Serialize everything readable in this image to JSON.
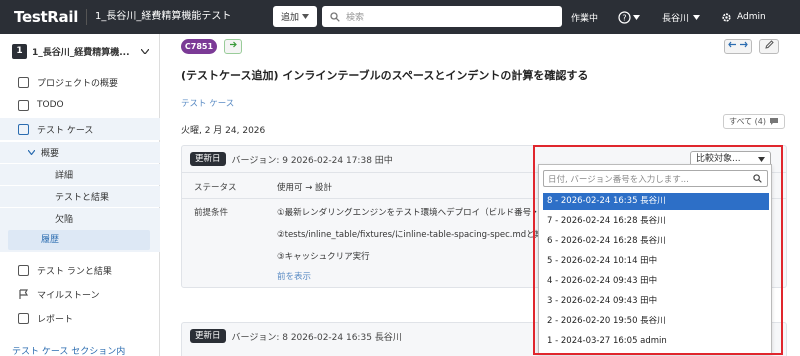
{
  "topbar": {
    "logo": "TestRail",
    "project_title": "1_長谷川_経費精算機能テスト",
    "add_label": "追加",
    "search_placeholder": "検索",
    "status": "作業中",
    "user": "長谷川",
    "admin": "Admin"
  },
  "sidebar": {
    "project_num": "1",
    "project_name": "1_長谷川_経費精算機...",
    "items": [
      {
        "label": "プロジェクトの概要"
      },
      {
        "label": "TODO"
      },
      {
        "label": "テスト ケース"
      },
      {
        "label": "概要"
      },
      {
        "label": "詳細"
      },
      {
        "label": "テストと結果"
      },
      {
        "label": "欠陥"
      },
      {
        "label": "履歴"
      },
      {
        "label": "テスト ランと結果"
      },
      {
        "label": "マイルストーン"
      },
      {
        "label": "レポート"
      }
    ],
    "footer": "テスト ケース セクション内"
  },
  "main": {
    "case_id": "C7851",
    "title": "(テストケース追加) インラインテーブルのスペースとインデントの計算を確認する",
    "section": "テスト ケース",
    "date": "火曜, 2 月 24, 2026",
    "all_label": "すべて (4)",
    "compare_label": "比較対象...",
    "card1": {
      "badge": "更新日",
      "header": "バージョン: 9  2026-02-24 17:38 田中",
      "status_label": "ステータス",
      "status_value": "使用可 → 設計",
      "precond_label": "前提条件",
      "lines": [
        "①最新レンダリングエンジンをテスト環境へデプロイ（ビルド番号・Commi",
        "②tests/inline_table/fixtures/にinline-table-spacing-spec.mdと期",
        "③キャッシュクリア実行"
      ],
      "show_prev": "前を表示"
    },
    "card2": {
      "badge": "更新日",
      "header": "バージョン: 8  2026-02-24 16:35 長谷川"
    }
  },
  "dropdown": {
    "placeholder": "日付, バージョン番号を入力します...",
    "options": [
      "8 - 2026-02-24 16:35 長谷川",
      "7 - 2026-02-24 16:28 長谷川",
      "6 - 2026-02-24 16:28 長谷川",
      "5 - 2026-02-24 10:14 田中",
      "4 - 2026-02-24 09:43 田中",
      "3 - 2026-02-24 09:43 田中",
      "2 - 2026-02-20 19:50 長谷川",
      "1 - 2024-03-27 16:05 admin"
    ],
    "selected_index": 0
  },
  "colors": {
    "topbar": "#2b2f36",
    "case_badge": "#7b3a96",
    "selected_option": "#2d6fc7",
    "highlight_frame": "#e0262d"
  }
}
